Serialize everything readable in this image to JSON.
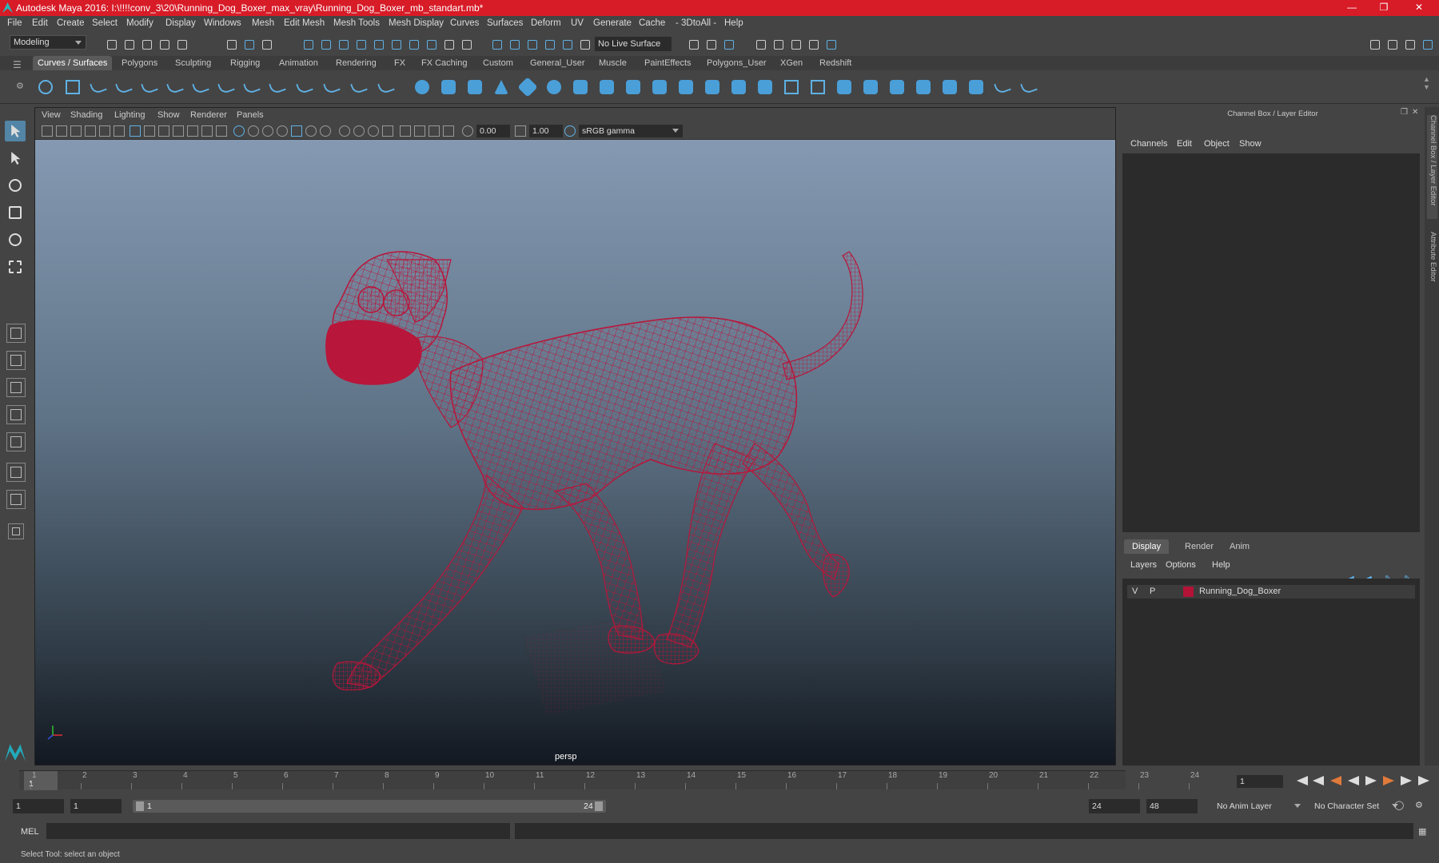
{
  "titlebar": {
    "title": "Autodesk Maya 2016: I:\\!!!!conv_3\\20\\Running_Dog_Boxer_max_vray\\Running_Dog_Boxer_mb_standart.mb*"
  },
  "menubar": [
    "File",
    "Edit",
    "Create",
    "Select",
    "Modify",
    "Display",
    "Windows",
    "Mesh",
    "Edit Mesh",
    "Mesh Tools",
    "Mesh Display",
    "Curves",
    "Surfaces",
    "Deform",
    "UV",
    "Generate",
    "Cache",
    "- 3DtoAll -",
    "Help"
  ],
  "statusline": {
    "mode": "Modeling",
    "live_surface": "No Live Surface"
  },
  "shelf_tabs": [
    "Curves / Surfaces",
    "Polygons",
    "Sculpting",
    "Rigging",
    "Animation",
    "Rendering",
    "FX",
    "FX Caching",
    "Custom",
    "General_User",
    "Muscle",
    "PaintEffects",
    "Polygons_User",
    "XGen",
    "Redshift"
  ],
  "viewport": {
    "menu": [
      "View",
      "Shading",
      "Lighting",
      "Show",
      "Renderer",
      "Panels"
    ],
    "exposure": "0.00",
    "gamma": "1.00",
    "color_space": "sRGB gamma",
    "camera": "persp",
    "wire_color": "#b8163a"
  },
  "channel_box": {
    "title": "Channel Box / Layer Editor",
    "menu": [
      "Channels",
      "Edit",
      "Object",
      "Show"
    ]
  },
  "layer_editor": {
    "tabs": [
      "Display",
      "Render",
      "Anim"
    ],
    "menu": [
      "Layers",
      "Options",
      "Help"
    ],
    "layer": {
      "v": "V",
      "p": "P",
      "name": "Running_Dog_Boxer",
      "color": "#b31336"
    }
  },
  "side_tabs": [
    "Channel Box / Layer Editor",
    "Attribute Editor"
  ],
  "timeline": {
    "ticks": [
      "1",
      "2",
      "3",
      "4",
      "5",
      "6",
      "7",
      "8",
      "9",
      "10",
      "11",
      "12",
      "13",
      "14",
      "15",
      "16",
      "17",
      "18",
      "19",
      "20",
      "21",
      "22",
      "23",
      "24"
    ],
    "current": "1",
    "current_frame_field": "1"
  },
  "range": {
    "start": "1",
    "playback_start": "1",
    "slider_start": "1",
    "slider_end": "24",
    "playback_end": "24",
    "end": "48",
    "anim_layer": "No Anim Layer",
    "character_set": "No Character Set"
  },
  "command_line": {
    "label": "MEL"
  },
  "help_line": {
    "text": "Select Tool: select an object"
  }
}
